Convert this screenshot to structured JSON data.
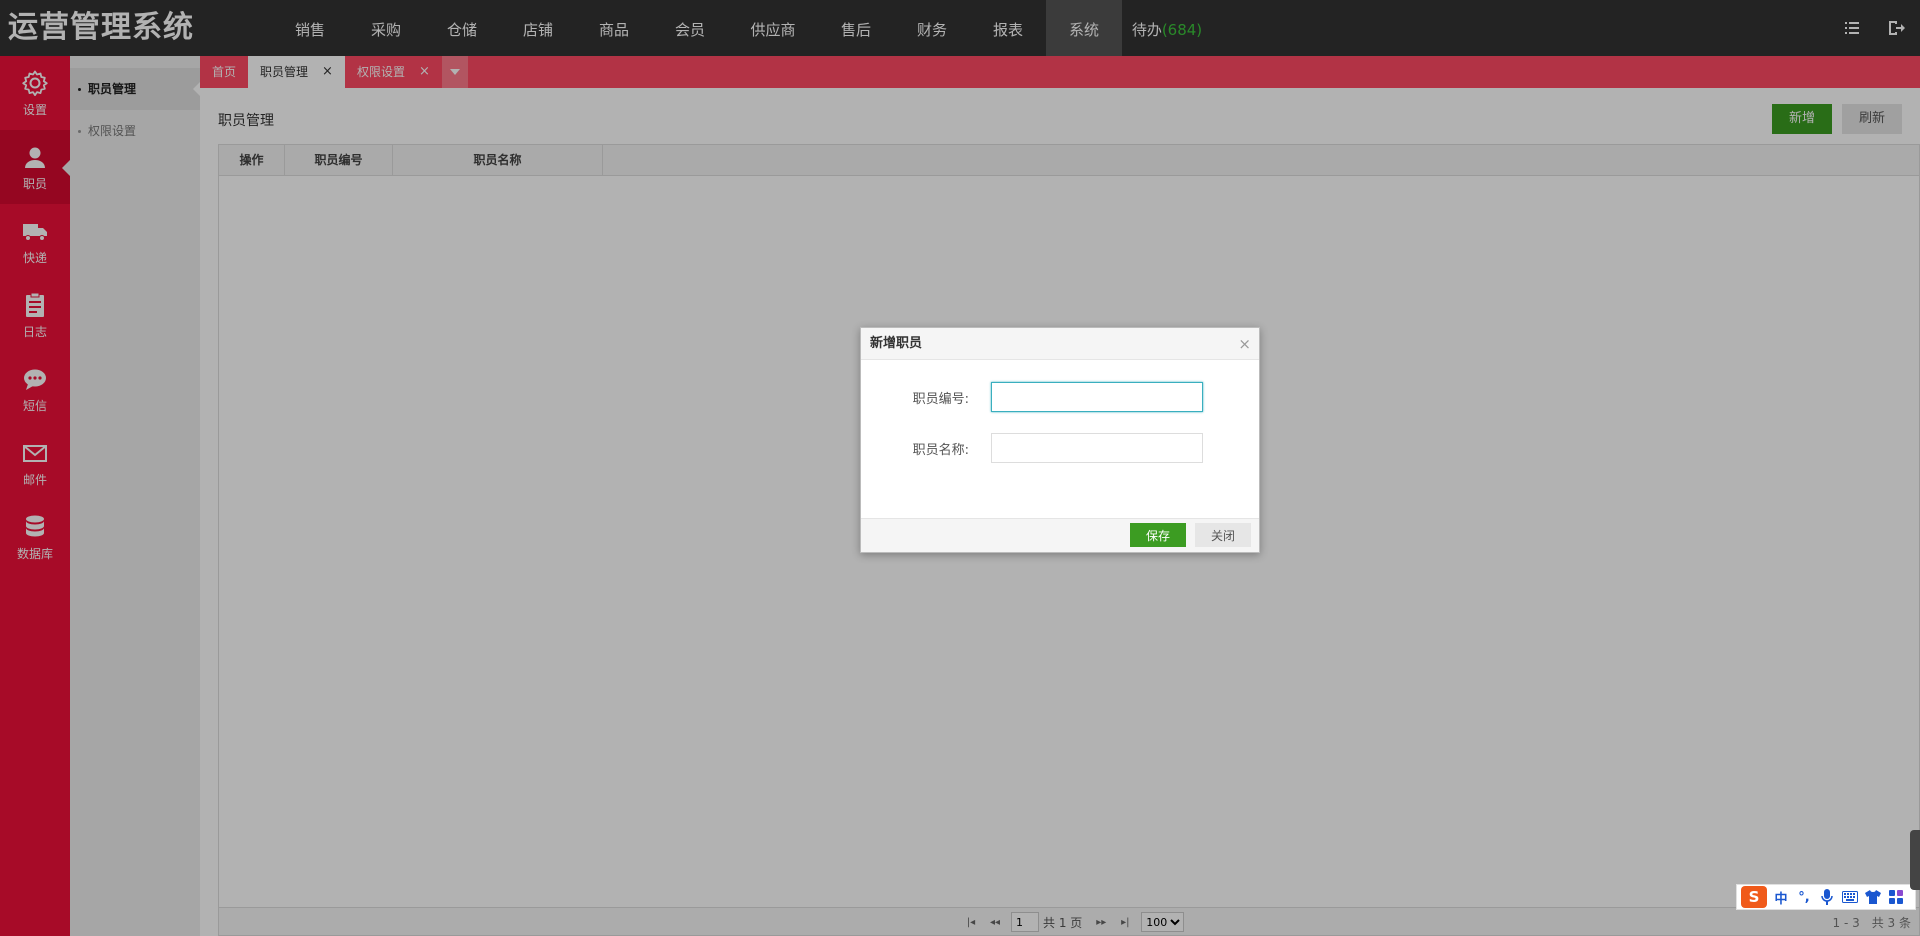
{
  "brand": {
    "title": "运营管理系统"
  },
  "nav": {
    "items": [
      {
        "label": "销售"
      },
      {
        "label": "采购"
      },
      {
        "label": "仓储"
      },
      {
        "label": "店铺"
      },
      {
        "label": "商品"
      },
      {
        "label": "会员"
      },
      {
        "label": "供应商"
      },
      {
        "label": "售后"
      },
      {
        "label": "财务"
      },
      {
        "label": "报表"
      },
      {
        "label": "系统"
      }
    ],
    "pending_label": "待办",
    "pending_count": "(684)",
    "active_index": 10
  },
  "sidebar": {
    "items": [
      {
        "label": "设置",
        "icon": "gear-icon"
      },
      {
        "label": "职员",
        "icon": "user-icon"
      },
      {
        "label": "快递",
        "icon": "truck-icon"
      },
      {
        "label": "日志",
        "icon": "clipboard-icon"
      },
      {
        "label": "短信",
        "icon": "chat-icon"
      },
      {
        "label": "邮件",
        "icon": "mail-icon"
      },
      {
        "label": "数据库",
        "icon": "database-icon"
      }
    ],
    "active_index": 1
  },
  "subnav": {
    "items": [
      {
        "label": "职员管理"
      },
      {
        "label": "权限设置"
      }
    ]
  },
  "tabs": {
    "items": [
      {
        "label": "首页"
      },
      {
        "label": "职员管理"
      },
      {
        "label": "权限设置"
      }
    ],
    "close_glyph": "×"
  },
  "page": {
    "title": "职员管理",
    "add_label": "新增",
    "refresh_label": "刷新"
  },
  "grid": {
    "columns": [
      "操作",
      "职员编号",
      "职员名称"
    ]
  },
  "pager": {
    "page_value": "1",
    "total_pages": "共 1 页",
    "page_size": "100",
    "range": "1 - 3　共 3 条"
  },
  "dialog": {
    "title": "新增职员",
    "close_glyph": "×",
    "field_code_label": "职员编号:",
    "field_code_value": "",
    "field_name_label": "职员名称:",
    "field_name_value": "",
    "save_label": "保存",
    "cancel_label": "关闭"
  },
  "ime": {
    "logo": "S",
    "mode": "中",
    "punct": "°,"
  },
  "colors": {
    "topbar": "#333333",
    "sidebar": "#f0103a",
    "tabs": "#ff4a63",
    "primary_button": "#3c9c22",
    "pending_count": "#3cc43c"
  }
}
